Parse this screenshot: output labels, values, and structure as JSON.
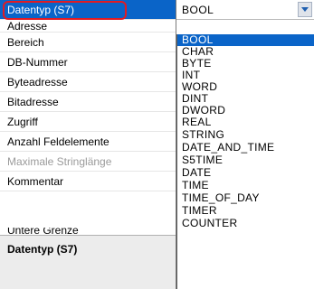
{
  "grid": {
    "rows": [
      "Datentyp (S7)",
      "Adresse",
      "Bereich",
      "DB-Nummer",
      "Byteadresse",
      "Bitadresse",
      "Zugriff",
      "Anzahl Feldelemente",
      "Maximale Stringlänge",
      "Kommentar",
      "Untere Grenze"
    ]
  },
  "combo": {
    "value": "BOOL"
  },
  "dropdown": {
    "options": [
      "BOOL",
      "CHAR",
      "BYTE",
      "INT",
      "WORD",
      "DINT",
      "DWORD",
      "REAL",
      "STRING",
      "DATE_AND_TIME",
      "S5TIME",
      "DATE",
      "TIME",
      "TIME_OF_DAY",
      "TIMER",
      "COUNTER"
    ]
  },
  "description": {
    "title": "Datentyp (S7)"
  },
  "colors": {
    "selection": "#0a64c8",
    "highlight": "#e11b23"
  }
}
